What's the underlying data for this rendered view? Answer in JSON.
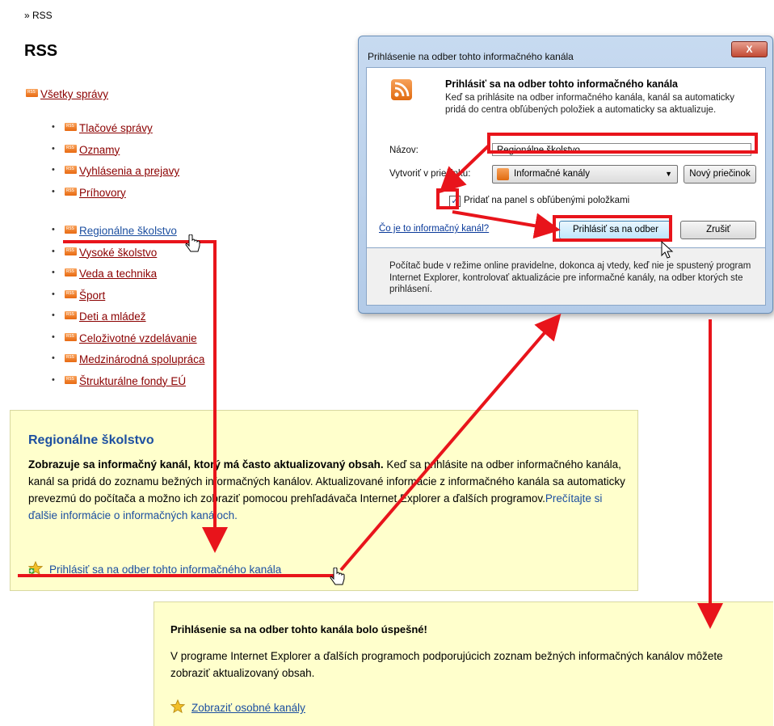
{
  "breadcrumb": "» RSS",
  "page_title": "RSS",
  "all_news": "Všetky správy",
  "feeds_group1": [
    "Tlačové správy",
    "Oznamy",
    "Vyhlásenia a prejavy",
    "Príhovory"
  ],
  "feeds_group2": [
    "Regionálne školstvo",
    "Vysoké školstvo",
    "Veda a technika",
    "Šport",
    "Deti a mládež",
    "Celoživotné vzdelávanie",
    "Medzinárodná spolupráca",
    "Štrukturálne fondy EÚ"
  ],
  "feed_panel": {
    "title": "Regionálne školstvo",
    "desc_bold": "Zobrazuje sa informačný kanál, ktorý má často aktualizovaný obsah.",
    "desc_text": " Keď sa prihlásite na odber informačného kanála, kanál sa pridá do zoznamu bežných informačných kanálov. Aktualizované informácie z informačného kanála sa automaticky prevezmú do počítača a možno ich zobraziť pomocou prehľadávača Internet Explorer a ďalších programov.",
    "more_link": "Prečítajte si ďalšie informácie o informačných kanáloch.",
    "subscribe_link": "Prihlásiť sa na odber tohto informačného kanála"
  },
  "success_panel": {
    "title": "Prihlásenie sa na odber tohto kanála bolo úspešné!",
    "desc": "V programe Internet Explorer a ďalších programoch podporujúcich zoznam bežných informačných kanálov môžete zobraziť aktualizovaný obsah.",
    "show_link": "Zobraziť osobné kanály"
  },
  "dialog": {
    "title": "Prihlásenie na odber tohto informačného kanála",
    "close_label": "X",
    "heading": "Prihlásiť sa na odber tohto informačného kanála",
    "desc": "Keď sa prihlásite na odber informačného kanála, kanál sa automaticky pridá do centra obľúbených položiek a automaticky sa aktualizuje.",
    "name_label": "Názov:",
    "name_value": "Regionálne školstvo",
    "folder_label": "Vytvoriť v priečinku:",
    "folder_value": "Informačné kanály",
    "new_folder_button": "Nový priečinok",
    "checkbox_label": "Pridať na panel s obľúbenými položkami",
    "checkbox_checked": true,
    "what_link": "Čo je to informačný kanál?",
    "subscribe_button": "Prihlásiť sa na odber",
    "cancel_button": "Zrušiť",
    "footer_text": "Počítač bude v režime online pravidelne, dokonca aj vtedy, keď nie je spustený program Internet Explorer, kontrolovať aktualizácie pre informačné kanály, na odber ktorých ste prihlásení."
  },
  "colors": {
    "annotation": "#e8141b",
    "link_blue": "#1c4fa0",
    "panel_yellow": "#ffffcc"
  }
}
